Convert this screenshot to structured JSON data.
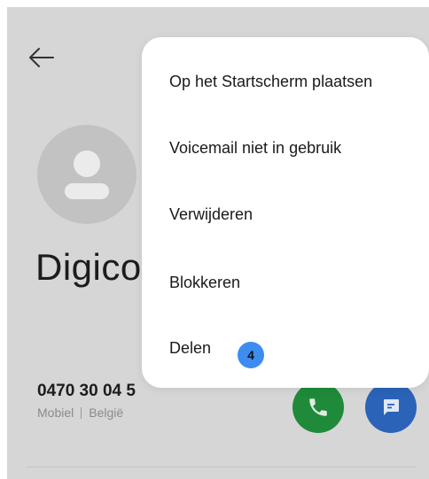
{
  "contact": {
    "name": "Digico",
    "phone_number": "0470 30 04 5",
    "phone_type": "Mobiel",
    "phone_country": "België"
  },
  "menu": {
    "items": [
      {
        "label": "Op het Startscherm plaatsen"
      },
      {
        "label": "Voicemail niet in gebruik"
      },
      {
        "label": "Verwijderen"
      },
      {
        "label": "Blokkeren"
      },
      {
        "label": "Delen"
      }
    ]
  },
  "badge": {
    "value": "4"
  },
  "icons": {
    "back": "arrow-left-icon",
    "avatar": "person-icon",
    "call": "phone-icon",
    "message": "chat-bubble-icon"
  },
  "colors": {
    "call_button": "#1f8a3a",
    "message_button": "#2a63b8",
    "badge": "#3d8cf0"
  }
}
